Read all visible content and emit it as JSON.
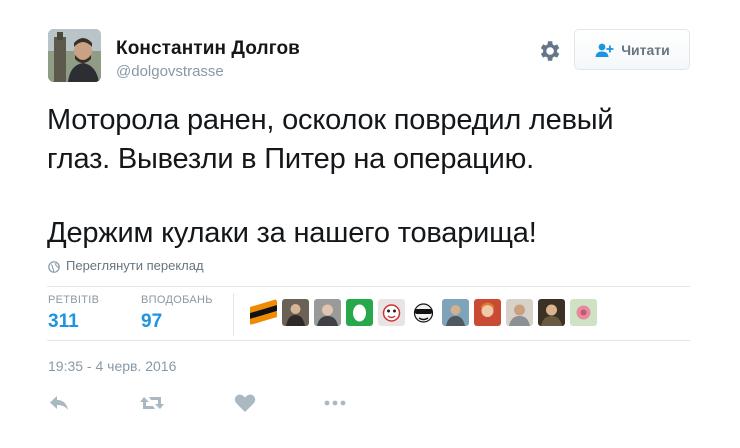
{
  "author": {
    "name": "Константин Долгов",
    "handle": "@dolgovstrasse"
  },
  "follow_button": {
    "label": "Читати",
    "icon": "add-user-icon"
  },
  "settings": {
    "icon": "gear-icon"
  },
  "tweet": {
    "lines": [
      "Моторола ранен, осколок повредил левый",
      "глаз. Вывезли в Питер на операцию.",
      "Держим кулаки за нашего товарища!"
    ]
  },
  "translate": {
    "label": "Переглянути переклад",
    "icon": "globe-icon"
  },
  "stats": {
    "retweets": {
      "label": "РЕТВІТІВ",
      "value": "311"
    },
    "likes": {
      "label": "ВПОДОБАНЬ",
      "value": "97"
    }
  },
  "liker_avatars": [
    "ribbon-avatar",
    "person-avatar",
    "person-avatar",
    "green-egg-avatar",
    "cartoon-avatar",
    "sunglasses-avatar",
    "person-avatar",
    "person-avatar",
    "person-avatar",
    "person-avatar",
    "flower-avatar"
  ],
  "timestamp": "19:35 - 4 черв. 2016",
  "actions": [
    {
      "icon": "reply-icon"
    },
    {
      "icon": "retweet-icon"
    },
    {
      "icon": "heart-icon"
    },
    {
      "icon": "more-icon"
    }
  ],
  "colors": {
    "link_blue": "#1b95e0",
    "muted_gray": "#8899a6",
    "icon_gray": "#aab8c2",
    "text": "#14171a"
  }
}
